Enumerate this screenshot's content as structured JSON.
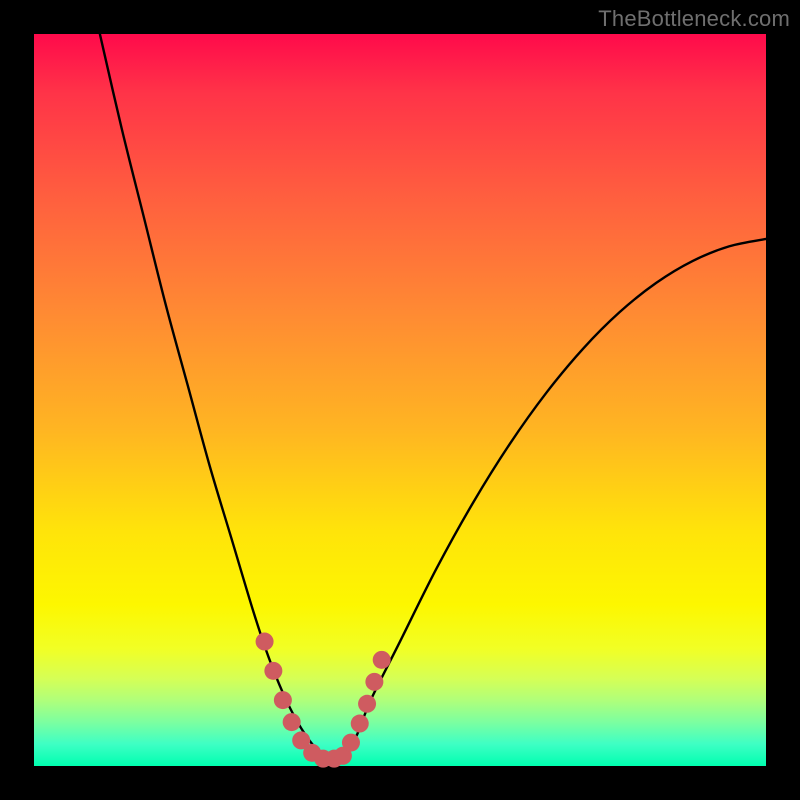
{
  "watermark": "TheBottleneck.com",
  "chart_data": {
    "type": "line",
    "title": "",
    "xlabel": "",
    "ylabel": "",
    "xlim": [
      0,
      100
    ],
    "ylim": [
      0,
      100
    ],
    "grid": false,
    "series": [
      {
        "name": "bottleneck-curve",
        "x": [
          9,
          12,
          15,
          18,
          21,
          24,
          27,
          30,
          32,
          34,
          36,
          38,
          40,
          42,
          44,
          46,
          50,
          55,
          60,
          65,
          70,
          75,
          80,
          85,
          90,
          95,
          100
        ],
        "y": [
          100,
          87,
          75,
          63,
          52,
          41,
          31,
          21,
          15,
          10,
          6,
          3,
          1,
          1,
          4,
          9,
          17,
          27,
          36,
          44,
          51,
          57,
          62,
          66,
          69,
          71,
          72
        ]
      }
    ],
    "markers": {
      "name": "highlight-dots",
      "color": "#cf5b60",
      "points": [
        {
          "x": 31.5,
          "y": 17
        },
        {
          "x": 32.7,
          "y": 13
        },
        {
          "x": 34.0,
          "y": 9
        },
        {
          "x": 35.2,
          "y": 6
        },
        {
          "x": 36.5,
          "y": 3.5
        },
        {
          "x": 38.0,
          "y": 1.8
        },
        {
          "x": 39.5,
          "y": 1.0
        },
        {
          "x": 41.0,
          "y": 1.0
        },
        {
          "x": 42.2,
          "y": 1.4
        },
        {
          "x": 43.3,
          "y": 3.2
        },
        {
          "x": 44.5,
          "y": 5.8
        },
        {
          "x": 45.5,
          "y": 8.5
        },
        {
          "x": 46.5,
          "y": 11.5
        },
        {
          "x": 47.5,
          "y": 14.5
        }
      ]
    }
  }
}
